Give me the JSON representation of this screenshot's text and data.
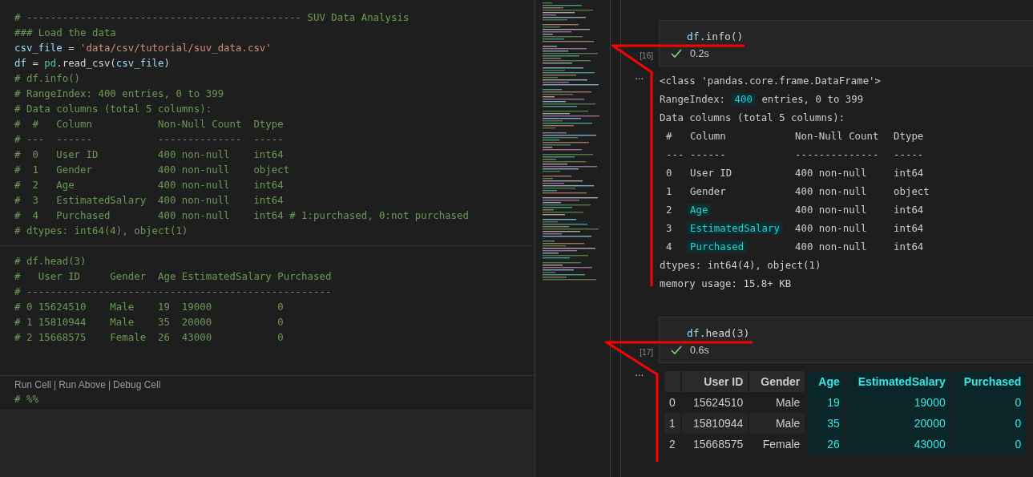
{
  "editor": {
    "code_lines": [
      [
        {
          "kind": "comment",
          "text": "# ---------------------------------------------- SUV Data Analysis"
        }
      ],
      [
        {
          "kind": "comment",
          "text": "### Load the data"
        }
      ],
      [
        {
          "kind": "variable",
          "text": "csv_file"
        },
        {
          "kind": "plain",
          "text": " = "
        },
        {
          "kind": "string",
          "text": "'data/csv/tutorial/suv_data.csv'"
        }
      ],
      [
        {
          "kind": "variable",
          "text": "df"
        },
        {
          "kind": "plain",
          "text": " = "
        },
        {
          "kind": "module",
          "text": "pd"
        },
        {
          "kind": "plain",
          "text": ".read_csv("
        },
        {
          "kind": "variable",
          "text": "csv_file"
        },
        {
          "kind": "plain",
          "text": ")"
        }
      ],
      [
        {
          "kind": "comment",
          "text": "# df.info()"
        }
      ],
      [
        {
          "kind": "comment",
          "text": "# RangeIndex: 400 entries, 0 to 399"
        }
      ],
      [
        {
          "kind": "comment",
          "text": "# Data columns (total 5 columns):"
        }
      ],
      [
        {
          "kind": "comment",
          "text": "#  #   Column           Non-Null Count  Dtype"
        }
      ],
      [
        {
          "kind": "comment",
          "text": "# ---  ------           --------------  -----"
        }
      ],
      [
        {
          "kind": "comment",
          "text": "#  0   User ID          400 non-null    int64"
        }
      ],
      [
        {
          "kind": "comment",
          "text": "#  1   Gender           400 non-null    object"
        }
      ],
      [
        {
          "kind": "comment",
          "text": "#  2   Age              400 non-null    int64"
        }
      ],
      [
        {
          "kind": "comment",
          "text": "#  3   EstimatedSalary  400 non-null    int64"
        }
      ],
      [
        {
          "kind": "comment",
          "text": "#  4   Purchased        400 non-null    int64 # 1:purchased, 0:not purchased"
        }
      ],
      [
        {
          "kind": "comment",
          "text": "# dtypes: int64(4), object(1)"
        }
      ]
    ],
    "code_lines_2": [
      [
        {
          "kind": "comment",
          "text": "# df.head(3)"
        }
      ],
      [
        {
          "kind": "comment",
          "text": "#   User ID     Gender  Age EstimatedSalary Purchased"
        }
      ],
      [
        {
          "kind": "comment",
          "text": "# ---------------------------------------------------"
        }
      ],
      [
        {
          "kind": "comment",
          "text": "# 0 15624510    Male    19  19000           0"
        }
      ],
      [
        {
          "kind": "comment",
          "text": "# 1 15810944    Male    35  20000           0"
        }
      ],
      [
        {
          "kind": "comment",
          "text": "# 2 15668575    Female  26  43000           0"
        }
      ]
    ],
    "codelens": {
      "links": [
        "Run Cell",
        "Run Above",
        "Debug Cell"
      ],
      "separator": "|"
    },
    "cell_marker": "# %%"
  },
  "notebook": {
    "cells": [
      {
        "kind": "info",
        "source": [
          {
            "kind": "variable",
            "text": "df"
          },
          {
            "kind": "plain",
            "text": ".info()"
          }
        ],
        "execution_count": "[16]",
        "duration": "0.2s",
        "output_more": "...",
        "output": {
          "lines_before": [
            [
              {
                "text": "<class 'pandas.core.frame.DataFrame'>",
                "highlighted": false
              }
            ],
            [
              {
                "text": "RangeIndex: ",
                "highlighted": false
              },
              {
                "text": "400",
                "highlighted": true
              },
              {
                "text": " entries, 0 to 399",
                "highlighted": false
              }
            ],
            [
              {
                "text": "Data columns (total 5 columns):",
                "highlighted": false
              }
            ]
          ],
          "header": {
            "index": "#",
            "name": "Column",
            "count": "Non-Null Count",
            "dtype": "Dtype"
          },
          "rule": {
            "index": "---",
            "name": "------",
            "count": "--------------",
            "dtype": "-----"
          },
          "columns": [
            {
              "index": "0",
              "name": "User ID",
              "count": "400 non-null",
              "dtype": "int64",
              "highlighted": false
            },
            {
              "index": "1",
              "name": "Gender",
              "count": "400 non-null",
              "dtype": "object",
              "highlighted": false
            },
            {
              "index": "2",
              "name": "Age",
              "count": "400 non-null",
              "dtype": "int64",
              "highlighted": true
            },
            {
              "index": "3",
              "name": "EstimatedSalary",
              "count": "400 non-null",
              "dtype": "int64",
              "highlighted": true
            },
            {
              "index": "4",
              "name": "Purchased",
              "count": "400 non-null",
              "dtype": "int64",
              "highlighted": true
            }
          ],
          "lines_after": [
            "dtypes: int64(4), object(1)",
            "memory usage: 15.8+ KB"
          ]
        }
      },
      {
        "kind": "table",
        "source": [
          {
            "kind": "variable",
            "text": "df"
          },
          {
            "kind": "plain",
            "text": ".head("
          },
          {
            "kind": "number",
            "text": "3"
          },
          {
            "kind": "plain",
            "text": ")"
          }
        ],
        "execution_count": "[17]",
        "duration": "0.6s",
        "output_more": "...",
        "table": {
          "columns": [
            {
              "label": "User ID",
              "highlighted": false
            },
            {
              "label": "Gender",
              "highlighted": false
            },
            {
              "label": "Age",
              "highlighted": true
            },
            {
              "label": "EstimatedSalary",
              "highlighted": true
            },
            {
              "label": "Purchased",
              "highlighted": true
            }
          ],
          "rows": [
            {
              "index": "0",
              "cells": [
                "15624510",
                "Male",
                "19",
                "19000",
                "0"
              ]
            },
            {
              "index": "1",
              "cells": [
                "15810944",
                "Male",
                "35",
                "20000",
                "0"
              ]
            },
            {
              "index": "2",
              "cells": [
                "15668575",
                "Female",
                "26",
                "43000",
                "0"
              ]
            }
          ]
        }
      }
    ]
  }
}
